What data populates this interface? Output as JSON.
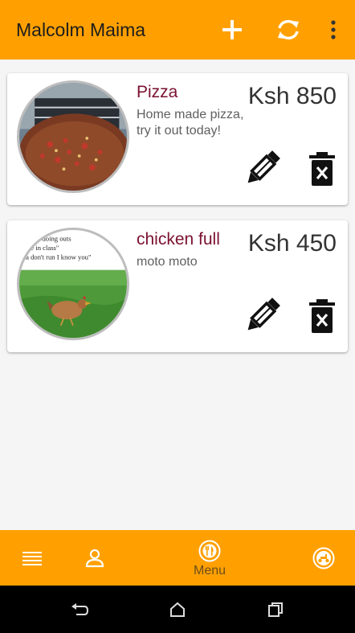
{
  "appbar": {
    "title": "Malcolm Maima",
    "actions": [
      {
        "icon": "add-icon"
      },
      {
        "icon": "sync-icon"
      },
      {
        "icon": "more-vert-icon"
      }
    ],
    "color": "#ffa000"
  },
  "items": [
    {
      "name": "Pizza",
      "description": "Home made pizza, try it out today!",
      "price": "Ksh 850",
      "image": "pizza-photo"
    },
    {
      "name": "chicken full",
      "description": "moto moto",
      "price": "Ksh 450",
      "image": "chicken-photo",
      "image_caption": [
        "you doing outs",
        "are in class\"",
        "na don't run I know you\""
      ]
    }
  ],
  "bottom_nav": {
    "items": [
      {
        "icon": "list-icon"
      },
      {
        "icon": "profile-icon"
      },
      {
        "icon": "restaurant-icon",
        "label": "Menu"
      },
      {
        "icon": "delivery-scooter-icon"
      }
    ],
    "color": "#ffa000"
  },
  "system_nav": [
    "back-icon",
    "home-icon",
    "recent-apps-icon"
  ],
  "colors": {
    "accent": "#ffa000",
    "item_name": "#7b1030"
  }
}
